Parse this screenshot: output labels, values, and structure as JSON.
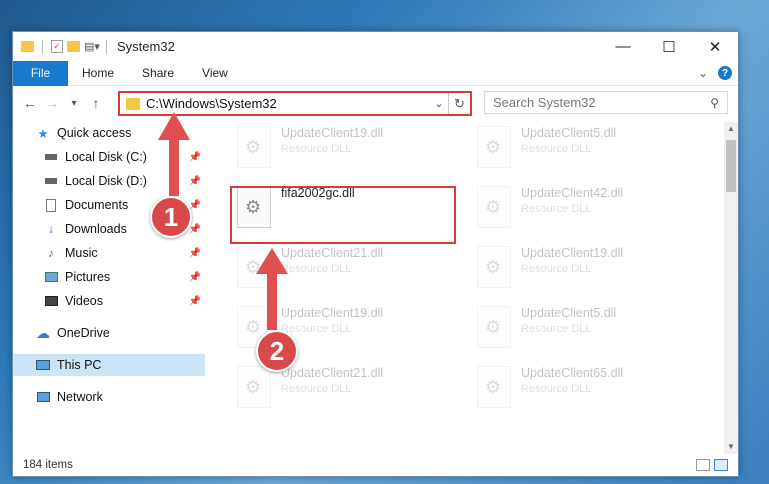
{
  "window": {
    "title": "System32",
    "controls": {
      "minimize": "—",
      "maximize": "☐",
      "close": "✕"
    }
  },
  "ribbon": {
    "file_tab": "File",
    "tabs": [
      "Home",
      "Share",
      "View"
    ]
  },
  "nav": {
    "back": "←",
    "forward": "→",
    "recent": "▾",
    "up": "↑",
    "address": "C:\\Windows\\System32",
    "search_placeholder": "Search System32"
  },
  "sidebar": {
    "items": [
      {
        "label": "Quick access",
        "icon": "star-icon"
      },
      {
        "label": "Local Disk (C:)",
        "icon": "drive-icon"
      },
      {
        "label": "Local Disk (D:)",
        "icon": "drive-icon"
      },
      {
        "label": "Documents",
        "icon": "documents-icon"
      },
      {
        "label": "Downloads",
        "icon": "download-icon"
      },
      {
        "label": "Music",
        "icon": "music-icon"
      },
      {
        "label": "Pictures",
        "icon": "pictures-icon"
      },
      {
        "label": "Videos",
        "icon": "videos-icon"
      },
      {
        "label": "OneDrive",
        "icon": "cloud-icon"
      },
      {
        "label": "This PC",
        "icon": "computer-icon"
      },
      {
        "label": "Network",
        "icon": "network-icon"
      }
    ]
  },
  "files": [
    {
      "name": "UpdateClient19.dll",
      "type": "Resource DLL"
    },
    {
      "name": "UpdateClient5.dll",
      "type": "Resource DLL"
    },
    {
      "name": "fifa2002gc.dll",
      "type": ""
    },
    {
      "name": "UpdateClient42.dll",
      "type": "Resource DLL"
    },
    {
      "name": "UpdateClient21.dll",
      "type": "Resource DLL"
    },
    {
      "name": "UpdateClient19.dll",
      "type": "Resource DLL"
    },
    {
      "name": "UpdateClient19.dll",
      "type": "Resource DLL"
    },
    {
      "name": "UpdateClient5.dll",
      "type": "Resource DLL"
    },
    {
      "name": "UpdateClient21.dll",
      "type": "Resource DLL"
    },
    {
      "name": "UpdateClient65.dll",
      "type": "Resource DLL"
    }
  ],
  "status": {
    "count": "184 items"
  },
  "callouts": {
    "one": "1",
    "two": "2"
  },
  "colors": {
    "accent": "#1979ca",
    "highlight": "#d83a3a",
    "arrow": "#e05050"
  }
}
